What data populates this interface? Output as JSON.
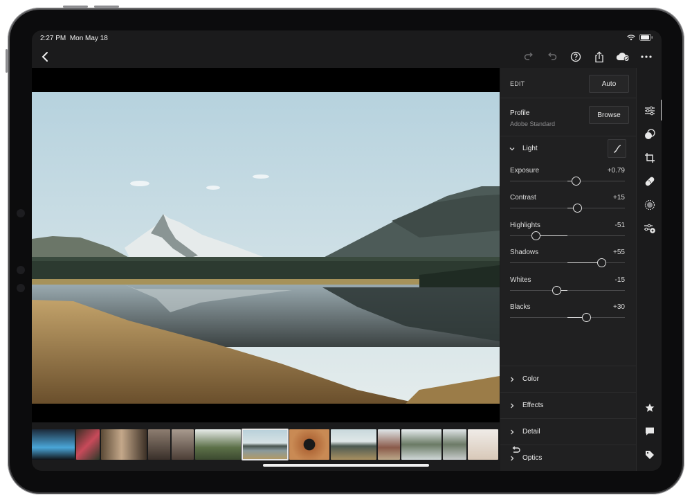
{
  "status": {
    "time": "2:27 PM",
    "date": "Mon May 18"
  },
  "edit": {
    "label": "EDIT",
    "auto_label": "Auto",
    "profile_label": "Profile",
    "profile_value": "Adobe Standard",
    "browse_label": "Browse"
  },
  "light": {
    "title": "Light",
    "sliders": [
      {
        "name": "Exposure",
        "value": "+0.79",
        "level": 0.58
      },
      {
        "name": "Contrast",
        "value": "+15",
        "level": 0.59
      },
      {
        "name": "Highlights",
        "value": "-51",
        "level": 0.23
      },
      {
        "name": "Shadows",
        "value": "+55",
        "level": 0.8
      },
      {
        "name": "Whites",
        "value": "-15",
        "level": 0.41
      },
      {
        "name": "Blacks",
        "value": "+30",
        "level": 0.67
      }
    ]
  },
  "sections": [
    {
      "title": "Color"
    },
    {
      "title": "Effects"
    },
    {
      "title": "Detail"
    },
    {
      "title": "Optics"
    }
  ],
  "colors": {
    "panel": "#202021",
    "screen": "#1b1b1c",
    "accent": "#e6e6e6"
  }
}
